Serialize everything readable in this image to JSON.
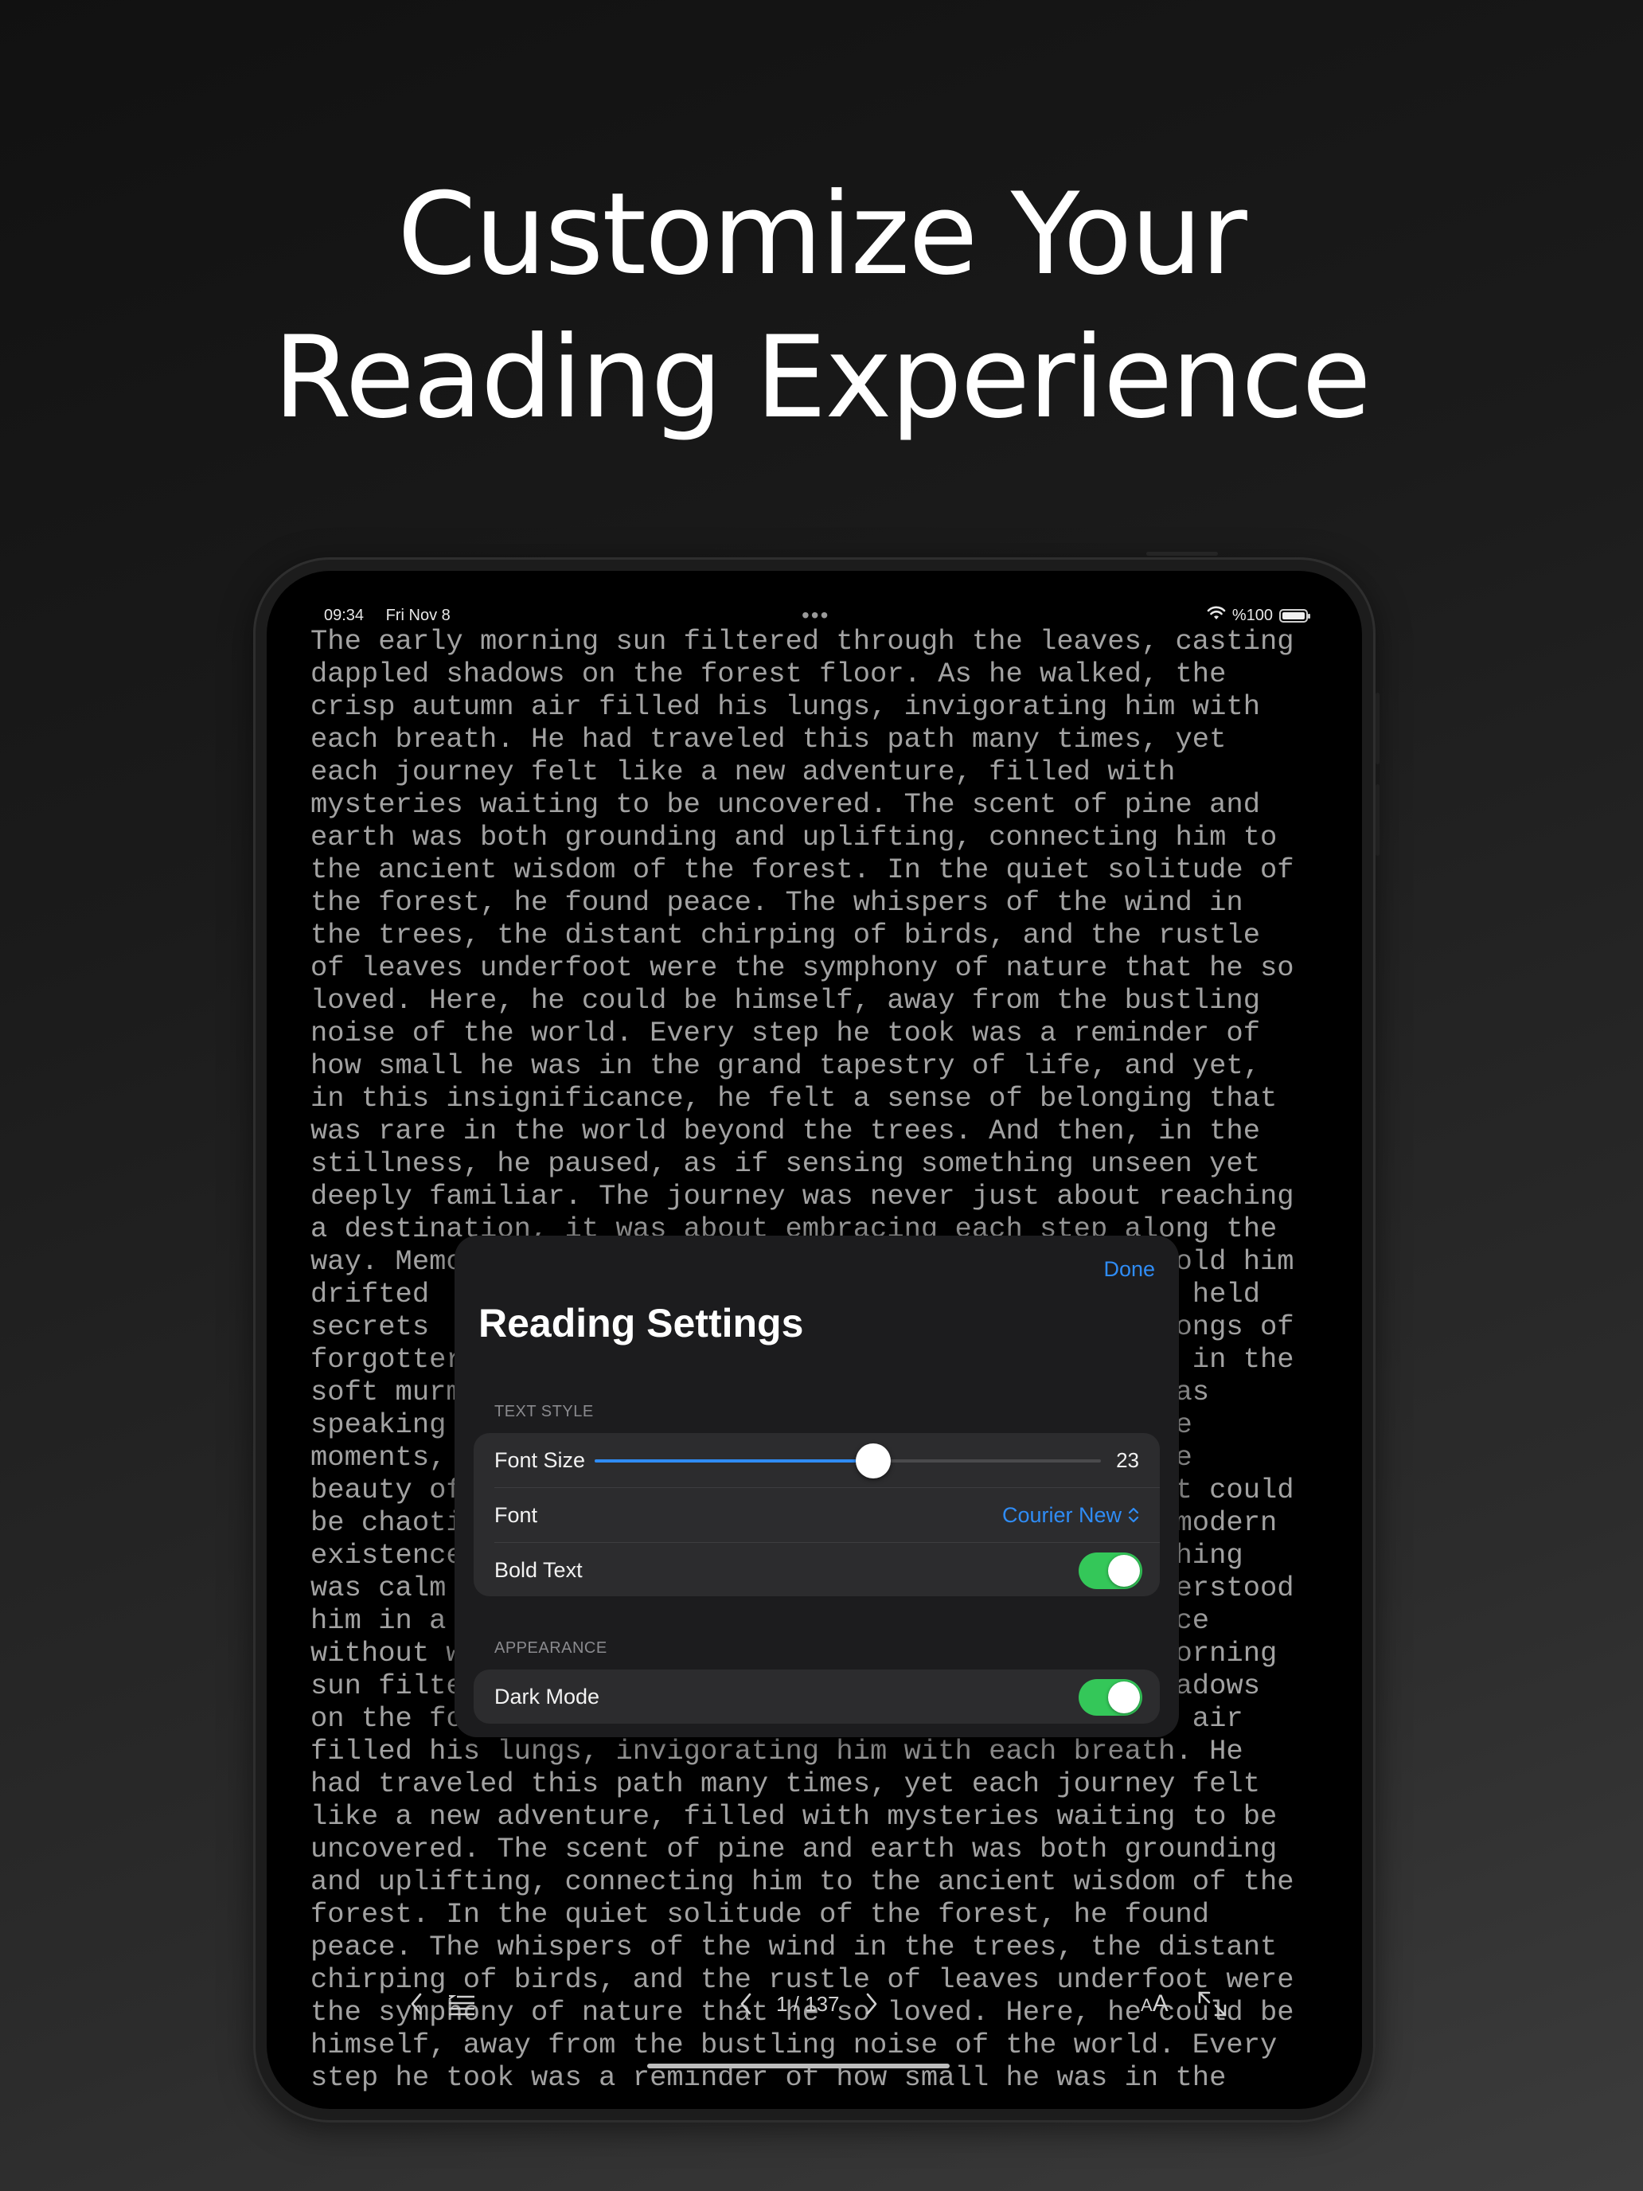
{
  "hero": {
    "line1": "Customize Your",
    "line2": "Reading Experience"
  },
  "status_bar": {
    "time": "09:34",
    "date": "Fri Nov 8",
    "dots": "•••",
    "battery": "%100",
    "icons": [
      "wifi-icon",
      "battery-icon"
    ]
  },
  "reading": {
    "text": "The early morning sun filtered through the leaves, casting\ndappled shadows on the forest floor. As he walked, the\ncrisp autumn air filled his lungs, invigorating him with\neach breath. He had traveled this path many times, yet\neach journey felt like a new adventure, filled with\nmysteries waiting to be uncovered. The scent of pine and\nearth was both grounding and uplifting, connecting him to\nthe ancient wisdom of the forest. In the quiet solitude of\nthe forest, he found peace. The whispers of the wind in\nthe trees, the distant chirping of birds, and the rustle\nof leaves underfoot were the symphony of nature that he so\nloved. Here, he could be himself, away from the bustling\nnoise of the world. Every step he took was a reminder of\nhow small he was in the grand tapestry of life, and yet,\nin this insignificance, he felt a sense of belonging that\nwas rare in the world beyond the trees. And then, in the\nstillness, he paused, as if sensing something unseen yet\ndeeply familiar. The journey was never just about reaching\na destination, it was about embracing each step along the\nway. Memo                                         told him\ndrifted                                           t held\nsecrets                                           songs of\nforgotter                                         s in the\nsoft murm                                         was\nspeaking                                          se\nmoments,                                          le\nbeauty of                                         st could\nbe chaoti                                          modern\nexistence                                         thing\nwas calm                                          derstood\nhim in a                                          ace\nwithout w                                         morning\nsun filte                                         hadows\non the fo                                         h air\nfilled his lungs, invigorating him with each breath. He\nhad traveled this path many times, yet each journey felt\nlike a new adventure, filled with mysteries waiting to be\nuncovered. The scent of pine and earth was both grounding\nand uplifting, connecting him to the ancient wisdom of the\nforest. In the quiet solitude of the forest, he found\npeace. The whispers of the wind in the trees, the distant\nchirping of birds, and the rustle of leaves underfoot were\nthe symphony of nature that he so loved. Here, he could be\nhimself, away from the bustling noise of the world. Every\nstep he took was a reminder of how small he was in the"
  },
  "settings": {
    "done_label": "Done",
    "title": "Reading Settings",
    "text_style_label": "TEXT STYLE",
    "font_size_label": "Font Size",
    "font_size_value": "23",
    "font_size_fraction": 0.55,
    "font_label": "Font",
    "font_value": "Courier New",
    "bold_label": "Bold Text",
    "bold_on": true,
    "appearance_label": "APPEARANCE",
    "dark_mode_label": "Dark Mode",
    "dark_mode_on": true
  },
  "toolbar": {
    "back_icon": "chevron-left-icon",
    "toc_icon": "table-of-contents-icon",
    "prev_icon": "chevron-left-icon",
    "page_indicator": "1 / 137",
    "next_icon": "chevron-right-icon",
    "text_settings_label": "AA",
    "expand_icon": "expand-icon"
  },
  "colors": {
    "accent": "#2f8cf5",
    "toggle_on": "#34c759",
    "reading_text": "#a2a2a2",
    "sheet_bg": "#1c1c1e"
  }
}
